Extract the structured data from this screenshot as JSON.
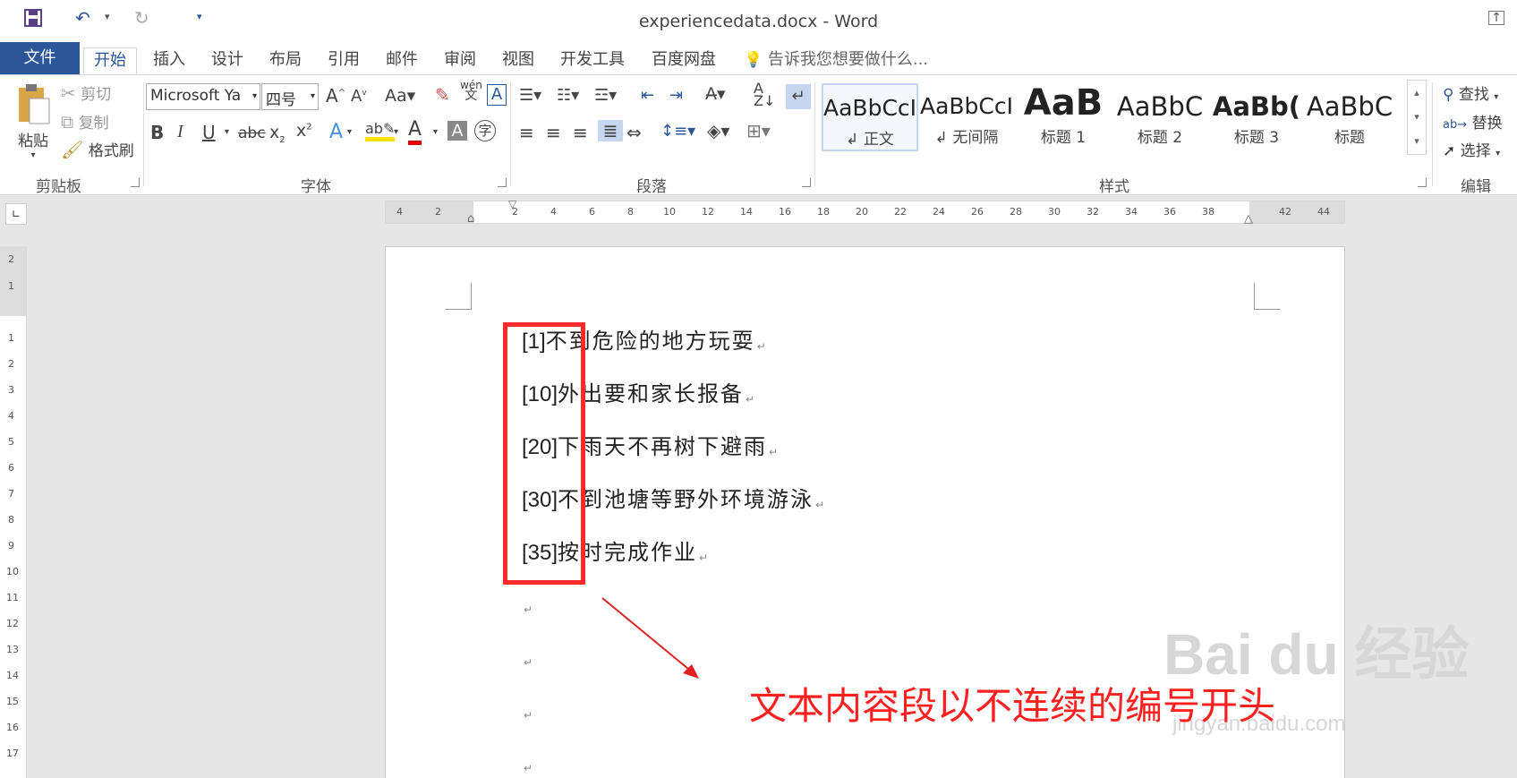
{
  "window": {
    "title": "experiencedata.docx - Word"
  },
  "tabs": [
    "文件",
    "开始",
    "插入",
    "设计",
    "布局",
    "引用",
    "邮件",
    "审阅",
    "视图",
    "开发工具",
    "百度网盘"
  ],
  "tell_me": "告诉我您想要做什么...",
  "clipboard": {
    "label": "剪贴板",
    "paste": "粘贴",
    "cut": "剪切",
    "copy": "复制",
    "format_painter": "格式刷"
  },
  "font": {
    "label": "字体",
    "name": "Microsoft Ya",
    "size": "四号",
    "pinyin_guide": "wén"
  },
  "paragraph": {
    "label": "段落"
  },
  "styles": {
    "label": "样式",
    "items": [
      {
        "sample": "AaBbCcI",
        "name": "正文"
      },
      {
        "sample": "AaBbCcI",
        "name": "无间隔"
      },
      {
        "sample": "AaB",
        "name": "标题 1"
      },
      {
        "sample": "AaBbC",
        "name": "标题 2"
      },
      {
        "sample": "AaBb(",
        "name": "标题 3"
      },
      {
        "sample": "AaBbC",
        "name": "标题"
      }
    ]
  },
  "editing": {
    "label": "编辑",
    "find": "查找",
    "replace": "替换",
    "select": "选择"
  },
  "ruler": {
    "h_ticks": [
      "4",
      "2",
      "2",
      "4",
      "6",
      "8",
      "10",
      "12",
      "14",
      "16",
      "18",
      "20",
      "22",
      "24",
      "26",
      "28",
      "30",
      "32",
      "34",
      "36",
      "38",
      "42",
      "44"
    ],
    "v_ticks": [
      "2",
      "1",
      "1",
      "2",
      "3",
      "4",
      "5",
      "6",
      "7",
      "8",
      "9",
      "10",
      "11",
      "12",
      "13",
      "14",
      "15",
      "16",
      "17"
    ]
  },
  "document": {
    "paragraphs": [
      {
        "num": "[1]",
        "text": "不到危险的地方玩耍"
      },
      {
        "num": "[10]",
        "text": "外出要和家长报备"
      },
      {
        "num": "[20]",
        "text": "下雨天不再树下避雨"
      },
      {
        "num": "[30]",
        "text": "不到池塘等野外环境游泳"
      },
      {
        "num": "[35]",
        "text": "按时完成作业"
      }
    ]
  },
  "annotation": "文本内容段以不连续的编号开头",
  "watermark": {
    "brand": "Bai du 经验",
    "url": "jingyan.baidu.com"
  },
  "colors": {
    "accent": "#2b579a",
    "annotation": "#ff2020"
  }
}
